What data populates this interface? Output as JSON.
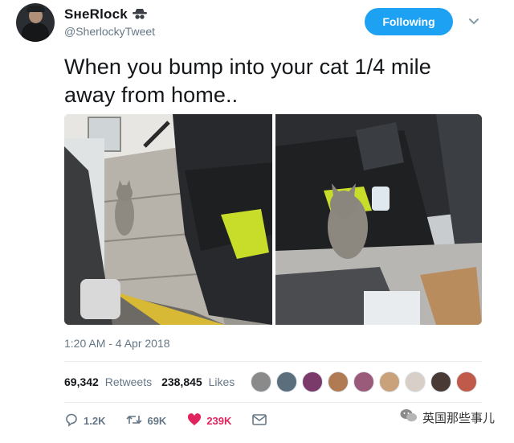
{
  "user": {
    "display_name": "SʜeRlock",
    "handle": "@SherlockyTweet",
    "emoji_icon": "spy-icon"
  },
  "follow_button": {
    "label": "Following"
  },
  "tweet": {
    "text_line1": "When you bump into your cat 1/4 mile",
    "text_line2": "away from home..",
    "timestamp": "1:20 AM - 4 Apr 2018"
  },
  "stats": {
    "retweets_count": "69,342",
    "retweets_label": "Retweets",
    "likes_count": "238,845",
    "likes_label": "Likes"
  },
  "liker_colors": [
    "#8a8a8a",
    "#5a6e7c",
    "#7a3a6a",
    "#b07a52",
    "#9a5a7a",
    "#c9a27c",
    "#d8d0c8",
    "#4a3a36",
    "#c05a4a"
  ],
  "actions": {
    "replies": "1.2K",
    "retweets": "69K",
    "likes": "239K"
  },
  "colors": {
    "accent": "#1da1f2",
    "like": "#e0245e",
    "muted": "#657786"
  },
  "watermark": {
    "text": "英国那些事儿"
  }
}
